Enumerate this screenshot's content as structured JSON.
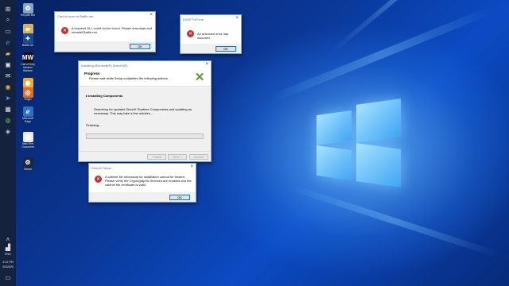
{
  "desktop": {
    "icons": [
      {
        "label": "Recycle Bin",
        "icon": "recycle-bin-icon",
        "glyph": "♻",
        "color": "#7fa6c9"
      },
      {
        "label": "",
        "icon": "folder-icon",
        "glyph": "▰",
        "color": "#d8b35a"
      },
      {
        "label": "Battle.net",
        "icon": "battlenet-icon",
        "glyph": "✦",
        "color": "#1c4a8f"
      },
      {
        "label": "Call of Duty Modern Warfare",
        "icon": "cod-icon",
        "glyph": "MW",
        "color": "#111111"
      },
      {
        "label": "Google Chrome",
        "icon": "chrome-icon",
        "glyph": "◉",
        "color": "#e8b12a"
      },
      {
        "label": "Origin",
        "icon": "origin-icon",
        "glyph": "◎",
        "color": "#e96b1f"
      },
      {
        "label": "Microsoft Edge",
        "icon": "edge-icon",
        "glyph": "ℯ",
        "color": "#2a6fc9"
      },
      {
        "label": "New Text Document",
        "icon": "text-document-icon",
        "glyph": "▤",
        "color": "#e8e8e8"
      },
      {
        "label": "Steam",
        "icon": "steam-icon",
        "glyph": "⚙",
        "color": "#1b2838"
      }
    ]
  },
  "taskbar": {
    "lang": "ENG",
    "time": "4:13 PM",
    "date": "4/3/2020"
  },
  "dialog_battlenet": {
    "title": "Cannot open in Battle.net",
    "message": "A required DLL could not be found. Please download and reinstall Battle.net.",
    "ok": "OK"
  },
  "dialog_unknown": {
    "title": "DXSETUP.exe",
    "message": "An unknown error has occurred.",
    "ok": "OK"
  },
  "dialog_setup": {
    "title": "Installing Microsoft(R) DirectX(R)",
    "heading": "Progress",
    "subheading": "Please wait while Setup completes the following actions.",
    "step": "Installing Components",
    "detail": "Searching for updated DirectX Runtime Components and updating as necessary. This may take a few minutes...",
    "status": "Finishing...",
    "progress": 0,
    "buttons": {
      "back": "< Back",
      "next": "Next >",
      "cancel": "Cancel"
    }
  },
  "dialog_cab": {
    "title": "DirectX Setup",
    "message": "A cabinet file necessary for installation cannot be trusted. Please verify the Cryptographic Services are enabled and the cabinet file certificate is valid.",
    "ok": "OK"
  }
}
